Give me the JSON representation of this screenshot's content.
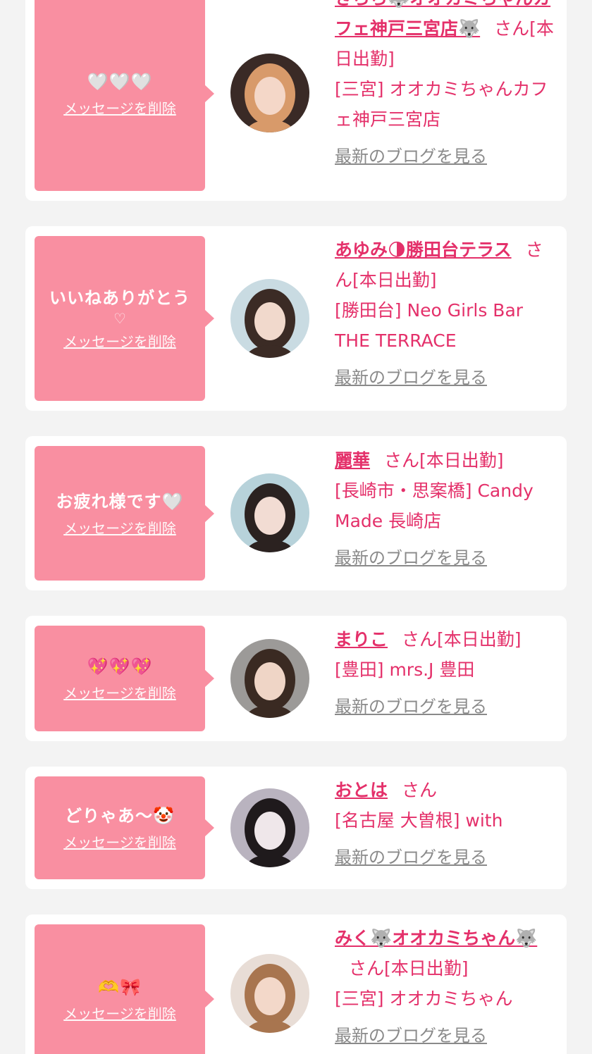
{
  "items": [
    {
      "message": "🤍🤍🤍",
      "message_sub": "",
      "delete_label": "メッセージを削除",
      "name": "きらら🐺オオカミちゃんカフェ神戸三宮店🐺",
      "suffix": "さん",
      "status": "[本日出勤]",
      "shop": "[三宮] オオカミちゃんカフェ神戸三宮店",
      "blog_label": "最新のブログを見る",
      "avatar": {
        "bg": "#3a2a26",
        "skin": "#f4d7c8",
        "hair": "#d89a6a"
      }
    },
    {
      "message": "いいねありがとう",
      "message_sub": "♡",
      "delete_label": "メッセージを削除",
      "name": "あゆみ🌗勝田台テラス",
      "suffix": "さん",
      "status": "[本日出勤]",
      "shop": "[勝田台] Neo Girls Bar THE TERRACE",
      "blog_label": "最新のブログを見る",
      "avatar": {
        "bg": "#c9dbe2",
        "skin": "#f1d9cc",
        "hair": "#3b2b25"
      }
    },
    {
      "message": "お疲れ様です🤍",
      "message_sub": "",
      "delete_label": "メッセージを削除",
      "name": "麗華",
      "suffix": "さん",
      "status": "[本日出勤]",
      "shop": "[長崎市・思案橋] Candy Made 長崎店",
      "blog_label": "最新のブログを見る",
      "avatar": {
        "bg": "#b7d2da",
        "skin": "#f2dcd3",
        "hair": "#2b2220"
      }
    },
    {
      "message": "💖💖💖",
      "message_sub": "",
      "delete_label": "メッセージを削除",
      "name": "まりこ",
      "suffix": "さん",
      "status": "[本日出勤]",
      "shop": "[豊田] mrs.J 豊田",
      "blog_label": "最新のブログを見る",
      "avatar": {
        "bg": "#9c9a98",
        "skin": "#efd5c6",
        "hair": "#3a2a22"
      }
    },
    {
      "message": "どりゃあ〜🤡",
      "message_sub": "",
      "delete_label": "メッセージを削除",
      "name": "おとは",
      "suffix": "さん",
      "status": "",
      "shop": "[名古屋 大曽根] with",
      "blog_label": "最新のブログを見る",
      "avatar": {
        "bg": "#b9b3bf",
        "skin": "#efe7ea",
        "hair": "#1f1a1c"
      }
    },
    {
      "message": "🫶🎀",
      "message_sub": "",
      "delete_label": "メッセージを削除",
      "name": "みく🐺オオカミちゃん🐺",
      "suffix": "さん",
      "status": "[本日出勤]",
      "shop": "[三宮] オオカミちゃん",
      "blog_label": "最新のブログを見る",
      "avatar": {
        "bg": "#e8ddd6",
        "skin": "#f3d8c9",
        "hair": "#a8754f"
      }
    }
  ]
}
